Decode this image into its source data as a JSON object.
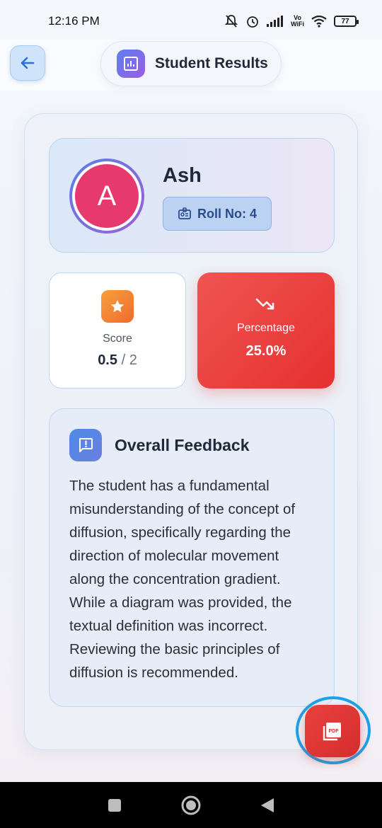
{
  "status_bar": {
    "time": "12:16 PM",
    "vowifi_top": "Vo",
    "vowifi_bottom": "WiFi",
    "battery": "77"
  },
  "header": {
    "title": "Student Results"
  },
  "student": {
    "avatar_letter": "A",
    "name": "Ash",
    "roll_label": "Roll No: 4"
  },
  "score": {
    "label": "Score",
    "value": "0.5",
    "separator": "/",
    "total": "2"
  },
  "percentage": {
    "label": "Percentage",
    "value": "25.0%"
  },
  "feedback": {
    "title": "Overall Feedback",
    "text": "The student has a fundamental misunderstanding of the concept of diffusion, specifically regarding the direction of molecular movement along the concentration gradient. While a diagram was provided, the textual definition was incorrect. Reviewing the basic principles of diffusion is recommended."
  },
  "pdf_button": {
    "label": "PDF"
  },
  "colors": {
    "accent_blue": "#4d8be6",
    "avatar": "#e8396e",
    "percentage_red": "#e5302f",
    "score_icon_orange": "#ef6a2c",
    "highlight_ring": "#1aa3e8"
  },
  "icons": {
    "back": "arrow-left-icon",
    "title": "bar-chart-icon",
    "roll": "id-badge-icon",
    "score": "star-icon",
    "percentage": "trending-down-icon",
    "feedback": "message-alert-icon",
    "pdf": "pdf-file-icon"
  }
}
